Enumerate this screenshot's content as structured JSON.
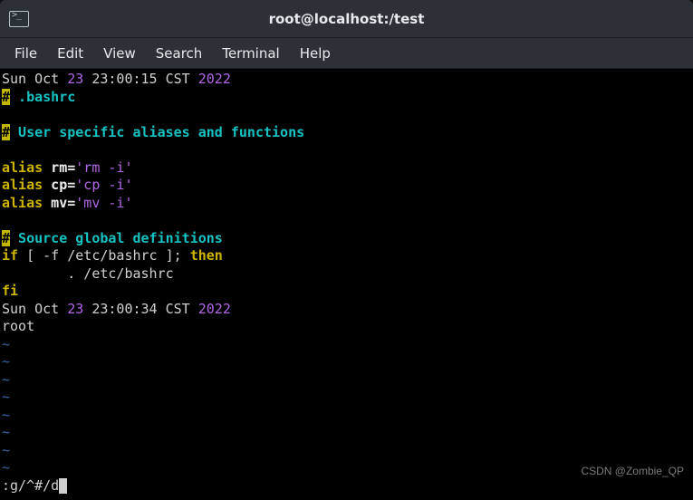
{
  "window": {
    "title": "root@localhost:/test"
  },
  "menu": {
    "file": "File",
    "edit": "Edit",
    "view": "View",
    "search": "Search",
    "terminal": "Terminal",
    "help": "Help"
  },
  "content": {
    "date1_prefix": "Sun Oct ",
    "date1_day": "23",
    "date1_mid": " 23:00:15 CST ",
    "date1_year": "2022",
    "hash": "#",
    "bashrc_label": " .bashrc",
    "comment1": " User specific aliases and functions",
    "alias_kw": "alias",
    "rm_name": " rm=",
    "rm_val": "'rm -i'",
    "cp_name": " cp=",
    "cp_val": "'cp -i'",
    "mv_name": " mv=",
    "mv_val": "'mv -i'",
    "comment2": " Source global definitions",
    "if_kw": "if",
    "if_cond": " [ -f /etc/bashrc ]; ",
    "then_kw": "then",
    "source_line": "        . /etc/bashrc",
    "fi_kw": "fi",
    "date2_prefix": "Sun Oct ",
    "date2_day": "23",
    "date2_mid": " 23:00:34 CST ",
    "date2_year": "2022",
    "root_line": "root",
    "tilde": "~",
    "cmd": ":g/^#/d"
  },
  "watermark": "CSDN @Zombie_QP"
}
